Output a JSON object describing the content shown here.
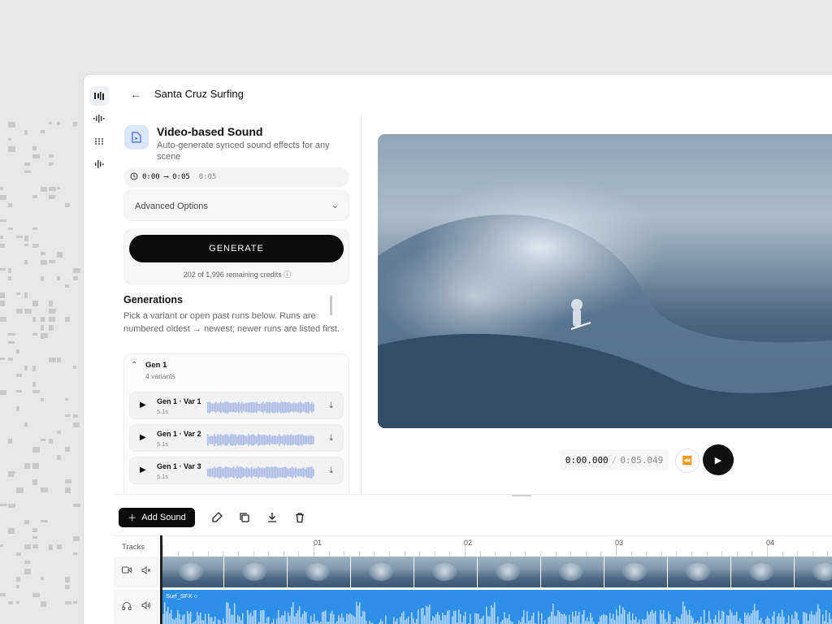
{
  "project": {
    "title": "Santa Cruz Surfing"
  },
  "rail": [
    {
      "icon": "waveform-logo-icon"
    },
    {
      "icon": "audio-wave-icon"
    },
    {
      "icon": "dots-grid-icon"
    },
    {
      "icon": "waveform-alt-icon"
    }
  ],
  "tool": {
    "title": "Video-based Sound",
    "description": "Auto-generate synced sound effects for any scene",
    "range_start": "0:00",
    "range_end": "0:05",
    "range_duration": "0:05"
  },
  "advanced": {
    "label": "Advanced Options"
  },
  "generate": {
    "label": "GENERATE",
    "credits": "202 of 1,996 remaining credits"
  },
  "generations": {
    "title": "Generations",
    "description": "Pick a variant or open past runs below. Runs are numbered oldest → newest; newer runs are listed first.",
    "groups": [
      {
        "name": "Gen 1",
        "count": "4 variants",
        "variants": [
          {
            "name": "Gen 1 · Var 1",
            "length": "5.1s"
          },
          {
            "name": "Gen 1 · Var 2",
            "length": "5.1s"
          },
          {
            "name": "Gen 1 · Var 3",
            "length": "5.1s"
          }
        ]
      }
    ]
  },
  "player": {
    "current": "0:00.000",
    "separator": "/",
    "duration": "0:05.049"
  },
  "toolbar": {
    "add_sound": "Add Sound"
  },
  "timeline": {
    "tracks_label": "Tracks",
    "ruler": [
      "01",
      "02",
      "03",
      "04"
    ],
    "audio_clip": "Surf_SFX"
  },
  "colors": {
    "accent": "#2e8fe8",
    "wave": "#a8bde6",
    "button": "#0c0c0c"
  }
}
